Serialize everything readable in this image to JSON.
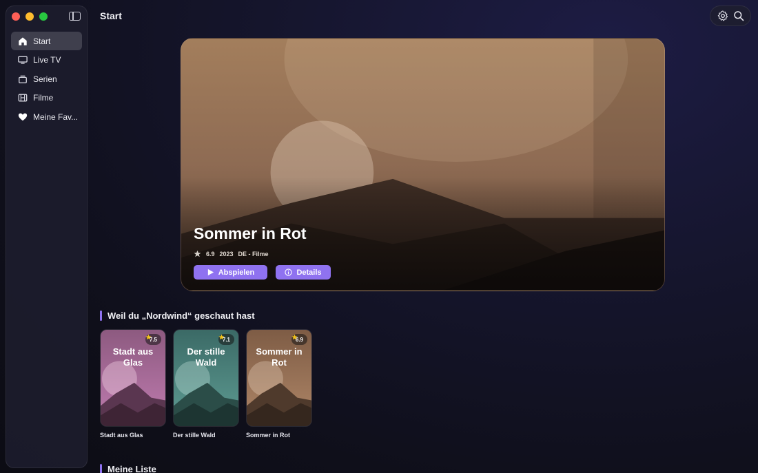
{
  "header": {
    "title": "Start"
  },
  "sidebar": {
    "items": [
      {
        "label": "Start",
        "icon": "home-icon",
        "active": true
      },
      {
        "label": "Live TV",
        "icon": "tv-icon",
        "active": false
      },
      {
        "label": "Serien",
        "icon": "stack-icon",
        "active": false
      },
      {
        "label": "Filme",
        "icon": "film-icon",
        "active": false
      },
      {
        "label": "Meine Fav...",
        "icon": "heart-icon",
        "active": false
      }
    ]
  },
  "hero": {
    "title": "Sommer in Rot",
    "rating": "6.9",
    "year": "2023",
    "category": "DE - Filme",
    "play_label": "Abspielen",
    "details_label": "Details"
  },
  "section_recommend": {
    "title": "Weil du „Nordwind“ geschaut hast",
    "cards": [
      {
        "title": "Stadt aus Glas",
        "rating": "7.5",
        "caption": "Stadt aus Glas",
        "color": "#b56fa2"
      },
      {
        "title": "Der stille Wald",
        "rating": "7.1",
        "caption": "Der stille Wald",
        "color": "#4f8d86"
      },
      {
        "title": "Sommer in Rot",
        "rating": "6.9",
        "caption": "Sommer in Rot",
        "color": "#a27a5b"
      }
    ]
  },
  "section_list": {
    "title": "Meine Liste"
  },
  "colors": {
    "accent": "#8f72f0",
    "star": "#f5c518"
  }
}
